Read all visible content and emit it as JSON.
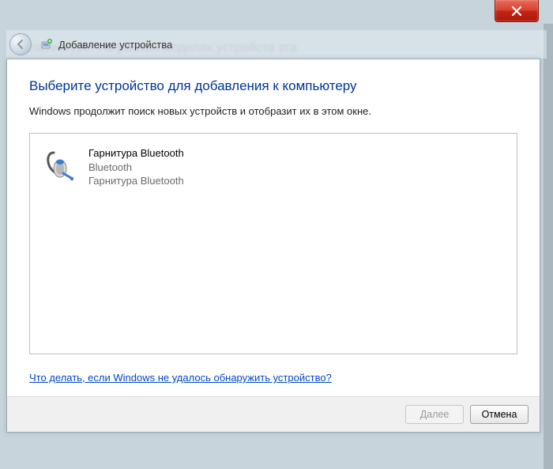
{
  "background": {
    "blur_text": "клавиатуре. На разных моделях устройств эта",
    "tabs": [
      "",
      ""
    ]
  },
  "titlebar": {
    "close_glyph": "✕"
  },
  "nav": {
    "title": "Добавление устройства"
  },
  "dialog": {
    "heading": "Выберите устройство для добавления к компьютеру",
    "subtext": "Windows продолжит поиск новых устройств и отобразит их в этом окне.",
    "help_link": "Что делать, если Windows не удалось обнаружить устройство?",
    "buttons": {
      "next": "Далее",
      "cancel": "Отмена"
    }
  },
  "devices": [
    {
      "name": "Гарнитура Bluetooth",
      "type": "Bluetooth",
      "desc": "Гарнитура Bluetooth"
    }
  ]
}
